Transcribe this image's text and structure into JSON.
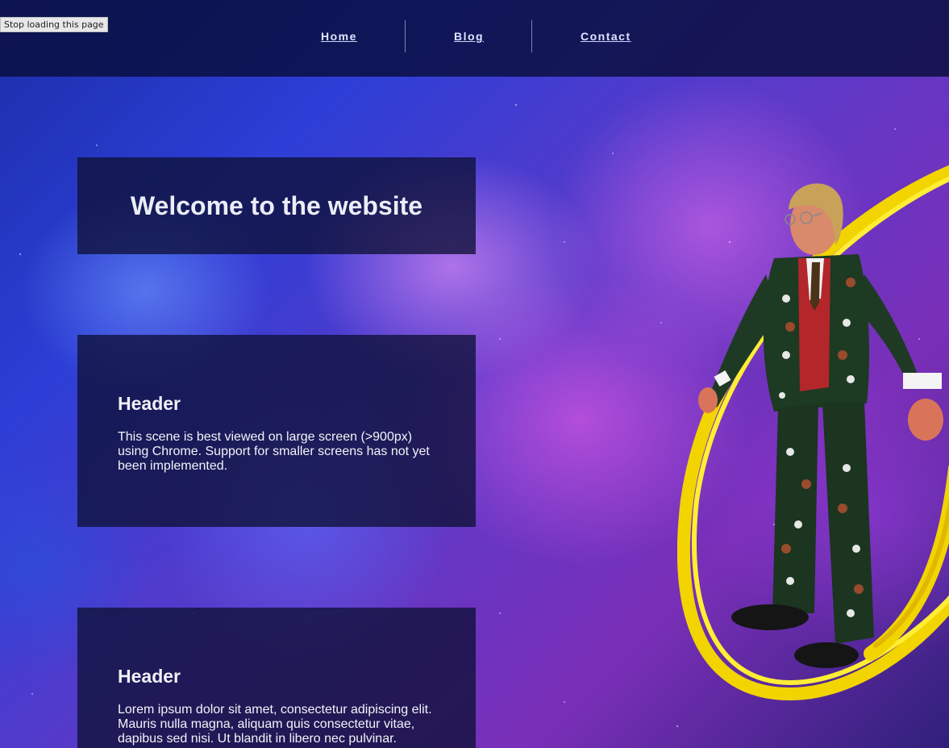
{
  "browser": {
    "tooltip": "Stop loading this page"
  },
  "nav": {
    "items": [
      {
        "label": "Home"
      },
      {
        "label": "Blog"
      },
      {
        "label": "Contact"
      }
    ]
  },
  "hero": {
    "title": "Welcome to the website"
  },
  "cards": [
    {
      "header": "Header",
      "body": "This scene is best viewed on large screen (>900px) using Chrome. Support for smaller screens has not yet been implemented."
    },
    {
      "header": "Header",
      "body": "Lorem ipsum dolor sit amet, consectetur adipiscing elit. Mauris nulla magna, aliquam quis consectetur vitae, dapibus sed nisi. Ut blandit in libero nec pulvinar."
    }
  ],
  "colors": {
    "nav_background": "#0b1240",
    "panel_background": "#0e1137",
    "ring": "#ffe600",
    "suit": "#1d3a22",
    "vest": "#b3262a"
  },
  "scene": {
    "background": "space nebula",
    "model": "3d-avatar-in-christmas-suit",
    "ring_icon": "yellow-ring-icon"
  }
}
